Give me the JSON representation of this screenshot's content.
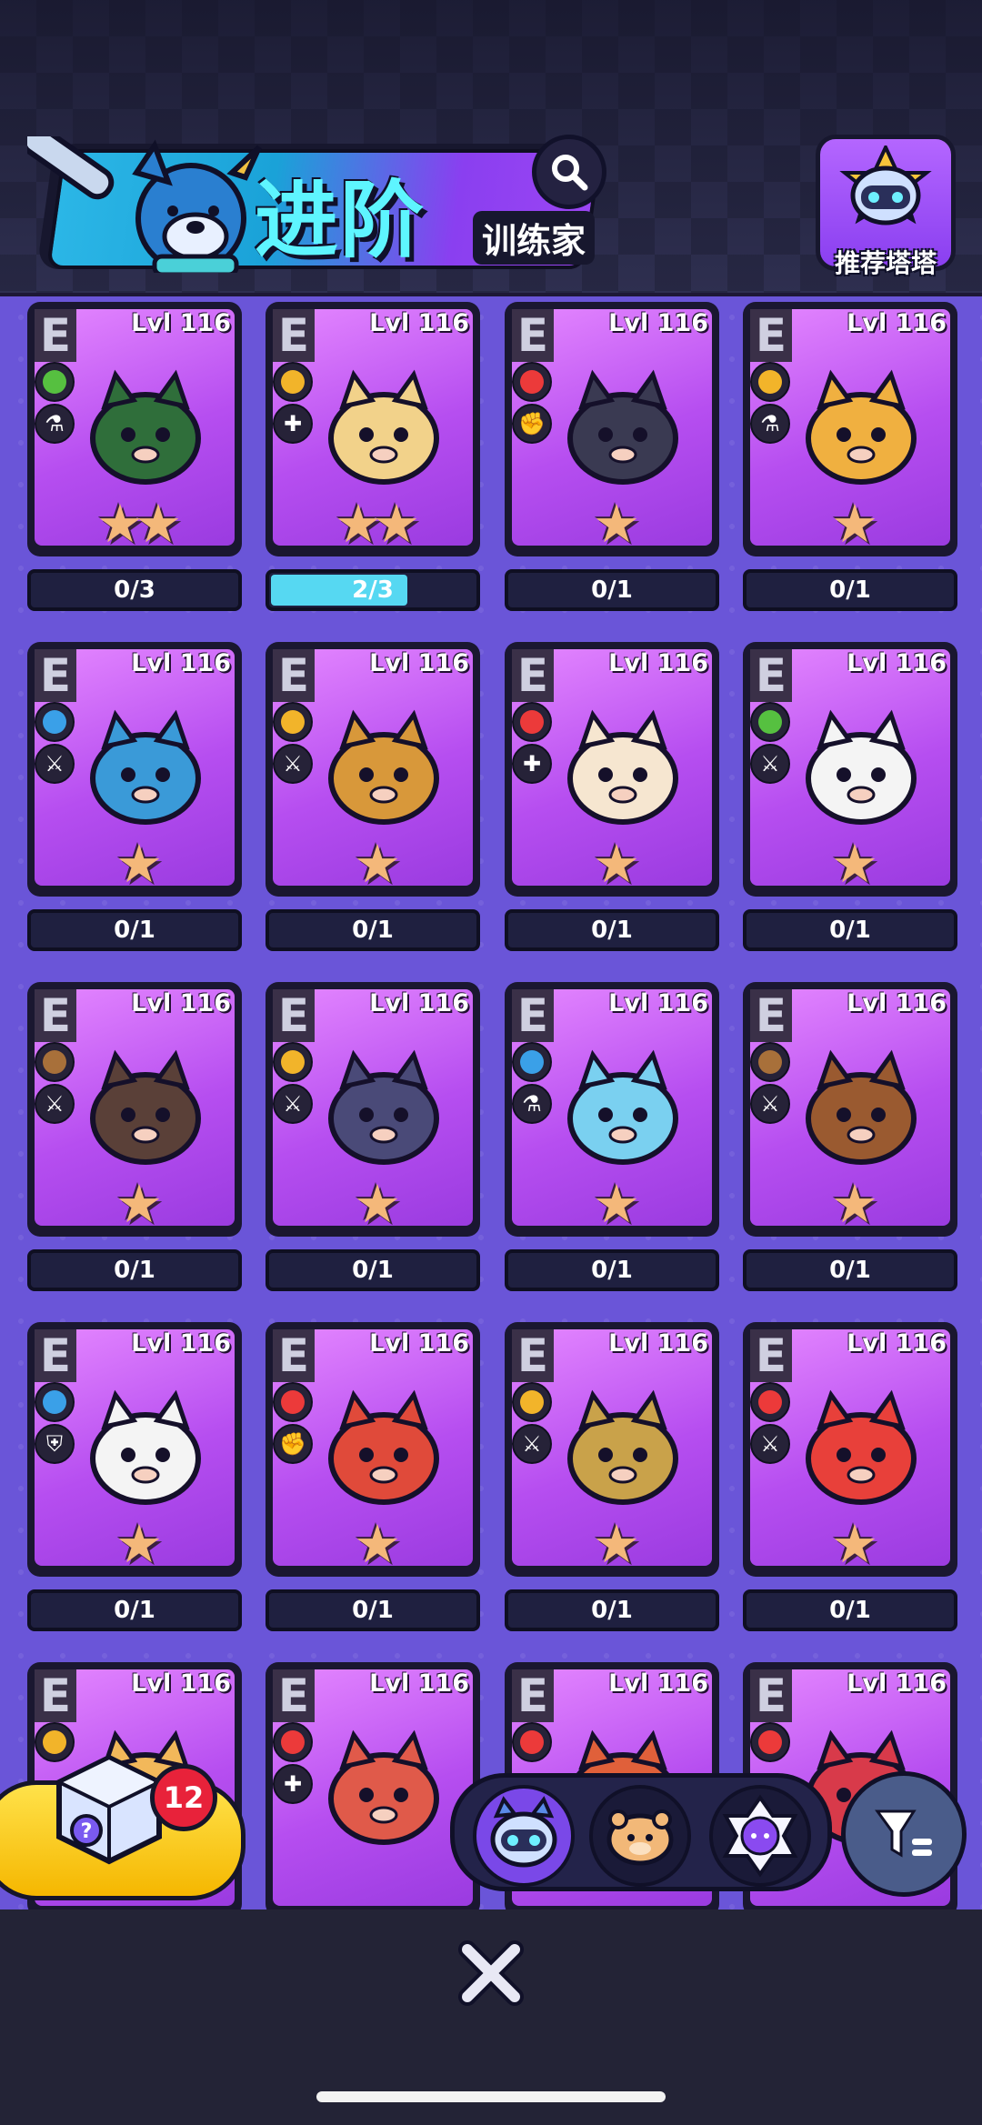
{
  "header": {
    "title": "进阶",
    "subtitle": "训练家",
    "recommend_label": "推荐塔塔"
  },
  "elements": {
    "grass": "#56c040",
    "electric": "#f2b42a",
    "fire": "#ec3a3a",
    "water": "#3aa0e8",
    "earth": "#a8703a"
  },
  "cards": [
    {
      "rank": "E",
      "level": "Lvl 116",
      "element": "grass",
      "class_icon": "potion-icon",
      "stars": 2,
      "progress": "0/3",
      "fill": 0,
      "art": "#2f6e3a"
    },
    {
      "rank": "E",
      "level": "Lvl 116",
      "element": "electric",
      "class_icon": "plus-icon",
      "stars": 2,
      "progress": "2/3",
      "fill": 0.67,
      "art": "#f2d28a"
    },
    {
      "rank": "E",
      "level": "Lvl 116",
      "element": "fire",
      "class_icon": "fist-icon",
      "stars": 1,
      "progress": "0/1",
      "fill": 0,
      "art": "#3a3a52"
    },
    {
      "rank": "E",
      "level": "Lvl 116",
      "element": "electric",
      "class_icon": "potion-icon",
      "stars": 1,
      "progress": "0/1",
      "fill": 0,
      "art": "#f0b040"
    },
    {
      "rank": "E",
      "level": "Lvl 116",
      "element": "water",
      "class_icon": "sword-icon",
      "stars": 1,
      "progress": "0/1",
      "fill": 0,
      "art": "#3a9ad8"
    },
    {
      "rank": "E",
      "level": "Lvl 116",
      "element": "electric",
      "class_icon": "sword-icon",
      "stars": 1,
      "progress": "0/1",
      "fill": 0,
      "art": "#d8983a"
    },
    {
      "rank": "E",
      "level": "Lvl 116",
      "element": "fire",
      "class_icon": "plus-icon",
      "stars": 1,
      "progress": "0/1",
      "fill": 0,
      "art": "#f6e6d0"
    },
    {
      "rank": "E",
      "level": "Lvl 116",
      "element": "grass",
      "class_icon": "sword-icon",
      "stars": 1,
      "progress": "0/1",
      "fill": 0,
      "art": "#f4f4f4"
    },
    {
      "rank": "E",
      "level": "Lvl 116",
      "element": "earth",
      "class_icon": "sword-icon",
      "stars": 1,
      "progress": "0/1",
      "fill": 0,
      "art": "#5a4038"
    },
    {
      "rank": "E",
      "level": "Lvl 116",
      "element": "electric",
      "class_icon": "sword-icon",
      "stars": 1,
      "progress": "0/1",
      "fill": 0,
      "art": "#4a4a78"
    },
    {
      "rank": "E",
      "level": "Lvl 116",
      "element": "water",
      "class_icon": "potion-icon",
      "stars": 1,
      "progress": "0/1",
      "fill": 0,
      "art": "#7ad0f0"
    },
    {
      "rank": "E",
      "level": "Lvl 116",
      "element": "earth",
      "class_icon": "sword-icon",
      "stars": 1,
      "progress": "0/1",
      "fill": 0,
      "art": "#9a5a30"
    },
    {
      "rank": "E",
      "level": "Lvl 116",
      "element": "water",
      "class_icon": "shield-icon",
      "stars": 1,
      "progress": "0/1",
      "fill": 0,
      "art": "#f4f4f4"
    },
    {
      "rank": "E",
      "level": "Lvl 116",
      "element": "fire",
      "class_icon": "fist-icon",
      "stars": 1,
      "progress": "0/1",
      "fill": 0,
      "art": "#e04a3a"
    },
    {
      "rank": "E",
      "level": "Lvl 116",
      "element": "electric",
      "class_icon": "sword-icon",
      "stars": 1,
      "progress": "0/1",
      "fill": 0,
      "art": "#c9a24a"
    },
    {
      "rank": "E",
      "level": "Lvl 116",
      "element": "fire",
      "class_icon": "sword-icon",
      "stars": 1,
      "progress": "0/1",
      "fill": 0,
      "art": "#e8403a"
    },
    {
      "rank": "E",
      "level": "Lvl 116",
      "element": "electric",
      "class_icon": "none",
      "stars": 0,
      "progress": "",
      "fill": 0,
      "art": "#f2b85a"
    },
    {
      "rank": "E",
      "level": "Lvl 116",
      "element": "fire",
      "class_icon": "plus-icon",
      "stars": 0,
      "progress": "",
      "fill": 0,
      "art": "#e05a4a"
    },
    {
      "rank": "E",
      "level": "Lvl 116",
      "element": "fire",
      "class_icon": "none",
      "stars": 0,
      "progress": "",
      "fill": 0,
      "art": "#e0603a"
    },
    {
      "rank": "E",
      "level": "Lvl 116",
      "element": "fire",
      "class_icon": "none",
      "stars": 0,
      "progress": "",
      "fill": 0,
      "art": "#d83a4a"
    }
  ],
  "capsule": {
    "count": "12"
  },
  "tabs": [
    {
      "name": "tab-robot-cat",
      "active": true
    },
    {
      "name": "tab-hamster",
      "active": false
    },
    {
      "name": "tab-crystal-cat",
      "active": false
    }
  ],
  "icons": {
    "search": "search-icon",
    "filter": "filter-icon",
    "close": "close-icon"
  }
}
